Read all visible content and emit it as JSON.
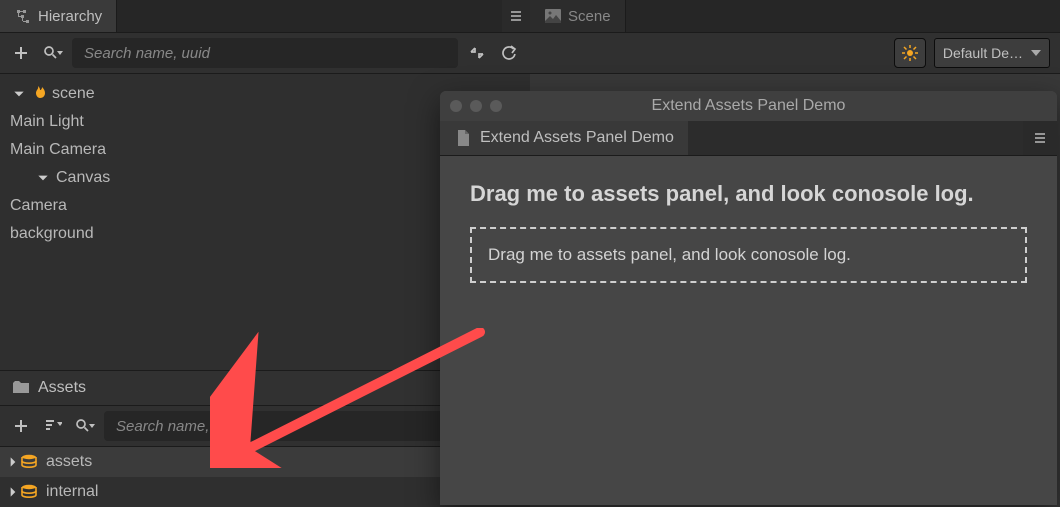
{
  "hierarchy": {
    "title": "Hierarchy",
    "search_placeholder": "Search name, uuid",
    "tree": {
      "root": "scene",
      "items": [
        "Main Light",
        "Main Camera",
        "Canvas"
      ],
      "canvas_children": [
        "Camera",
        "background"
      ]
    }
  },
  "assets": {
    "title": "Assets",
    "search_placeholder": "Search name, uuid",
    "items": [
      "assets",
      "internal"
    ]
  },
  "scene": {
    "title": "Scene",
    "device_label": "Default De…"
  },
  "floatwin": {
    "window_title": "Extend Assets Panel Demo",
    "tab_label": "Extend Assets Panel Demo",
    "heading": "Drag me to assets panel, and look conosole log.",
    "drag_text": "Drag me to assets panel, and look conosole log."
  }
}
